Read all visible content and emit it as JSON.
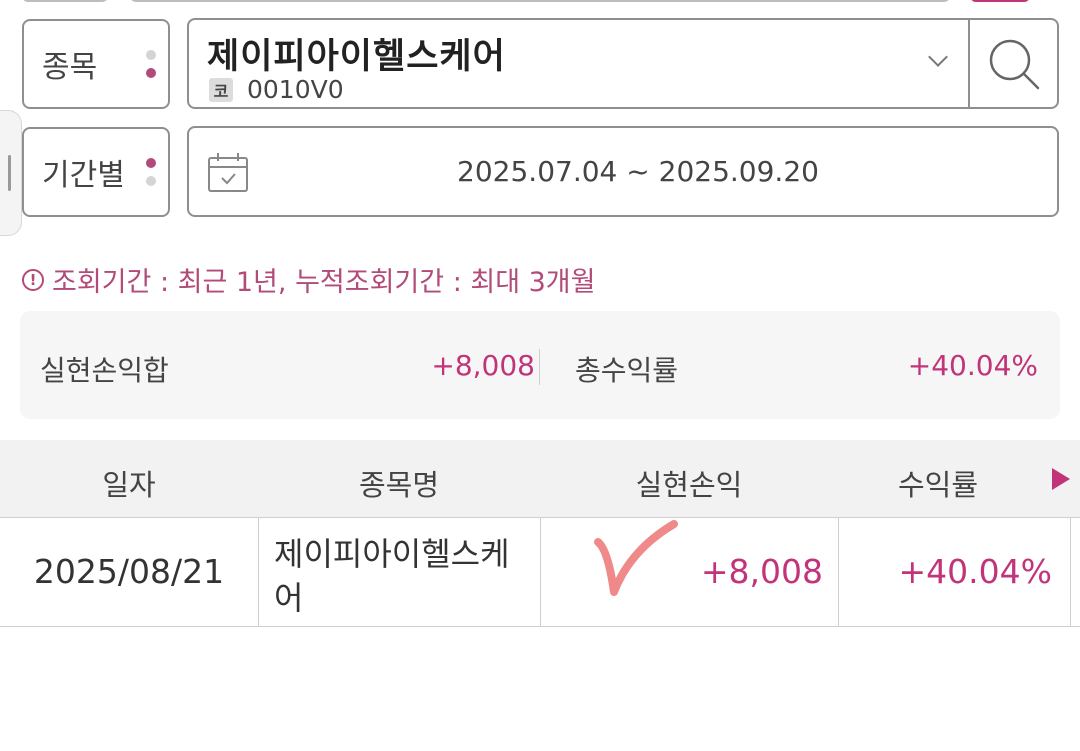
{
  "stock": {
    "label": "종목",
    "name": "제이피아이헬스케어",
    "market_tag": "코",
    "code": "0010V0"
  },
  "period": {
    "label": "기간별",
    "range": "2025.07.04 ~ 2025.09.20"
  },
  "notice": {
    "icon": "!",
    "text": "조회기간 : 최근 1년, 누적조회기간 : 최대 3개월"
  },
  "summary": {
    "pl_label": "실현손익합",
    "pl_value": "+8,008",
    "rate_label": "총수익률",
    "rate_value": "+40.04%"
  },
  "table": {
    "headers": [
      "일자",
      "종목명",
      "실현손익",
      "수익률"
    ],
    "rows": [
      {
        "date": "2025/08/21",
        "name": "제이피아이헬스케어",
        "pl": "+8,008",
        "rate": "+40.04%"
      }
    ]
  },
  "colors": {
    "accent": "#c2347a",
    "notice": "#b24a7a",
    "check_mark": "#f08a8a"
  },
  "icons": [
    "search-icon",
    "chevron-down-icon",
    "calendar-icon",
    "info-icon",
    "scroll-right-icon"
  ]
}
